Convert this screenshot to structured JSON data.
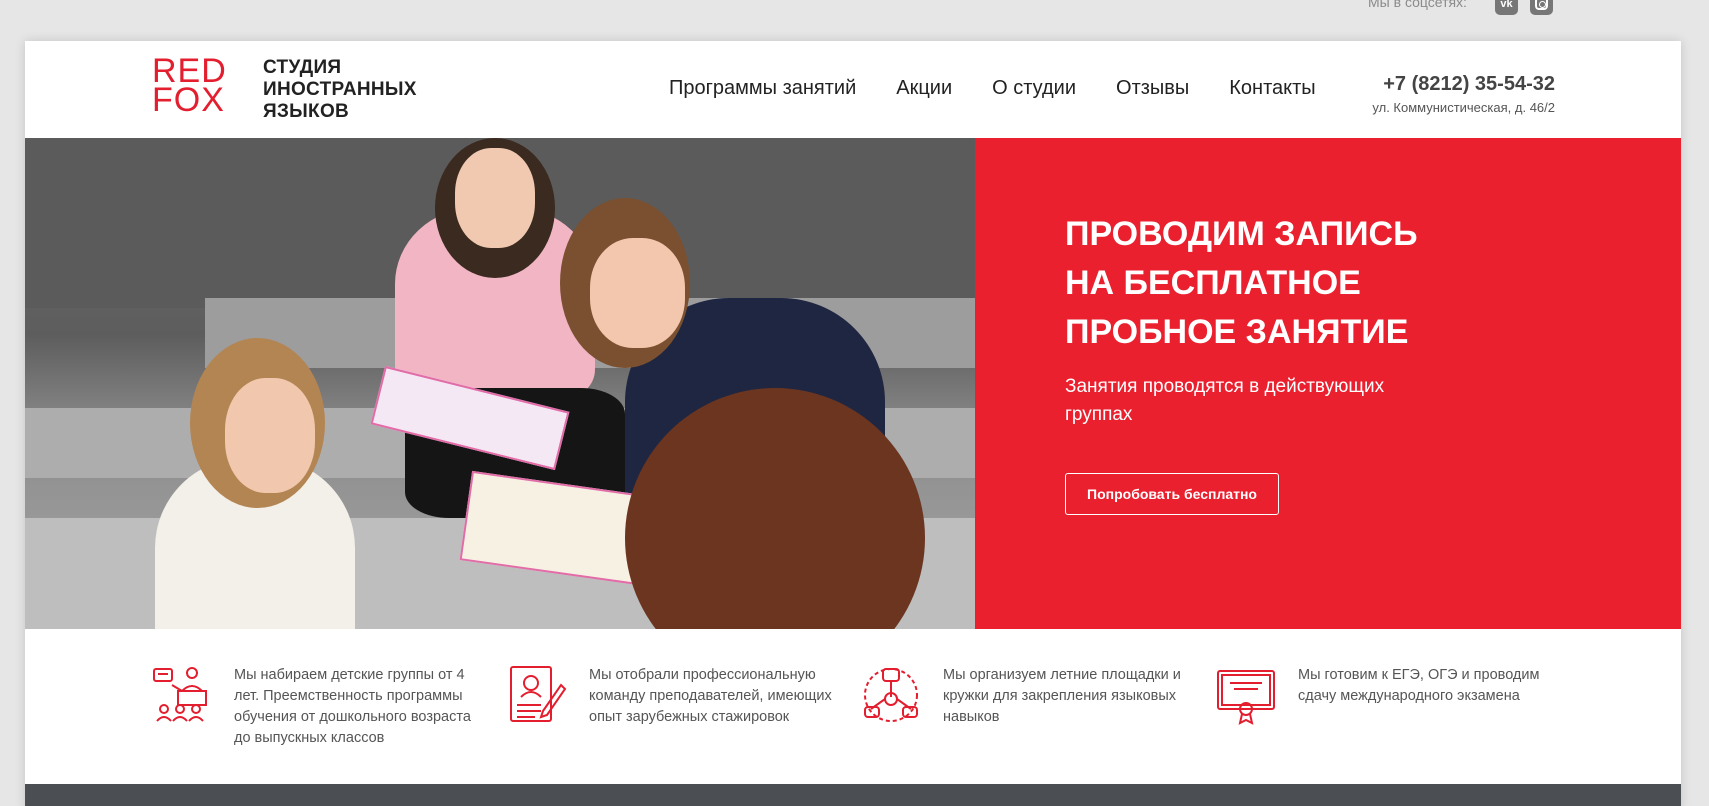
{
  "social": {
    "label": "Мы в соцсетях:",
    "icons": [
      "vk-icon",
      "instagram-icon"
    ]
  },
  "logo": {
    "red_line1": "RED",
    "red_line2": "FOX",
    "text_line1": "СТУДИЯ",
    "text_line2": "ИНОСТРАННЫХ",
    "text_line3": "ЯЗЫКОВ"
  },
  "nav": {
    "items": [
      {
        "label": "Программы занятий"
      },
      {
        "label": "Акции"
      },
      {
        "label": "О студии"
      },
      {
        "label": "Отзывы"
      },
      {
        "label": "Контакты"
      }
    ]
  },
  "contact": {
    "phone": "+7 (8212) 35-54-32",
    "address": "ул. Коммунистическая, д. 46/2"
  },
  "hero": {
    "title_line1": "ПРОВОДИМ ЗАПИСЬ",
    "title_line2": "НА БЕСПЛАТНОЕ",
    "title_line3": "ПРОБНОЕ ЗАНЯТИЕ",
    "subtitle": "Занятия проводятся в действующих группах",
    "button_label": "Попробовать бесплатно"
  },
  "features": [
    {
      "icon": "teacher-group-icon",
      "text": "Мы набираем детские группы от 4 лет. Преемственность программы обучения от дошкольного возраста до выпускных классов"
    },
    {
      "icon": "resume-pen-icon",
      "text": "Мы отобрали профессиональную команду преподавателей, имеющих опыт зарубежных стажировок"
    },
    {
      "icon": "hands-together-icon",
      "text": "Мы организуем летние площадки и кружки для закрепления языковых навыков"
    },
    {
      "icon": "certificate-icon",
      "text": "Мы готовим к ЕГЭ, ОГЭ и проводим сдачу международного экзамена"
    }
  ],
  "colors": {
    "brand_red": "#ea202f",
    "logo_red": "#e31e2e",
    "footer_dark": "#4b4f53"
  }
}
